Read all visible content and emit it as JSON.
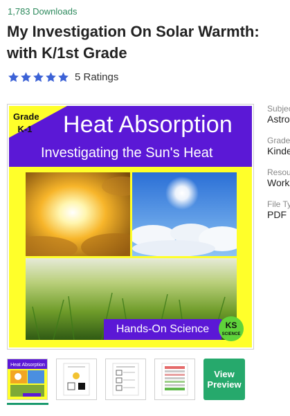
{
  "product": {
    "downloads": "1,783 Downloads",
    "title": "My Investigation On Solar Warmth: with K/1st Grade",
    "ratings_count": "5 Ratings",
    "rating_value": 5,
    "star_color": "#3c62d6"
  },
  "cover": {
    "grade_line1": "Grade",
    "grade_line2": "K-1",
    "title": "Heat Absorption",
    "subtitle": "Investigating the Sun's Heat",
    "banner": "Hands-On Science",
    "badge_line1": "KS",
    "badge_line2": "SCIENCE",
    "colors": {
      "purple": "#5b18d6",
      "yellow": "#ffff2a",
      "badge": "#5fd33b"
    }
  },
  "meta": [
    {
      "label": "Subject",
      "value": "Astronomy"
    },
    {
      "label": "Grade",
      "value": "Kindergarten"
    },
    {
      "label": "Resource",
      "value": "Worksheets"
    },
    {
      "label": "File Type",
      "value": "PDF"
    }
  ],
  "thumbnails": {
    "thumb1_title": "Heat Absorption",
    "view_preview_line1": "View",
    "view_preview_line2": "Preview"
  }
}
